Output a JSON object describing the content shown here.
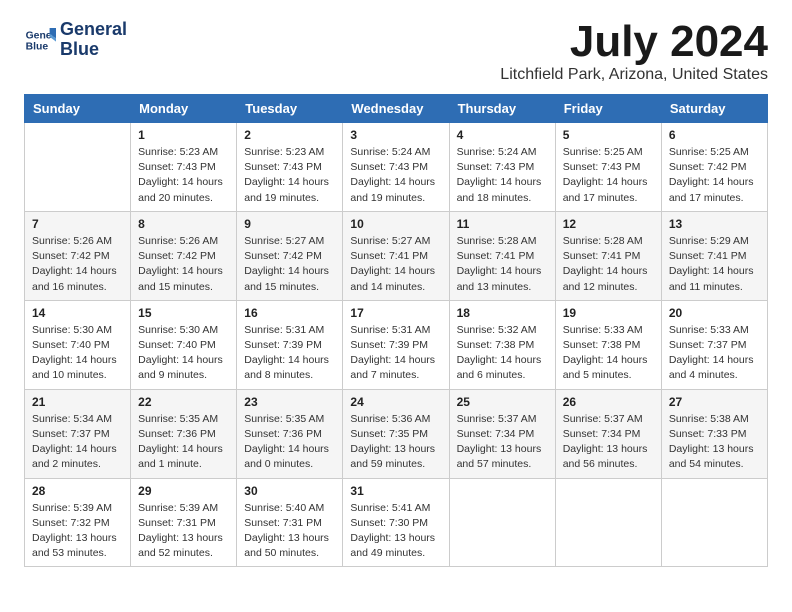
{
  "logo": {
    "line1": "General",
    "line2": "Blue"
  },
  "title": "July 2024",
  "location": "Litchfield Park, Arizona, United States",
  "days_of_week": [
    "Sunday",
    "Monday",
    "Tuesday",
    "Wednesday",
    "Thursday",
    "Friday",
    "Saturday"
  ],
  "weeks": [
    [
      {
        "date": "",
        "info": ""
      },
      {
        "date": "1",
        "info": "Sunrise: 5:23 AM\nSunset: 7:43 PM\nDaylight: 14 hours\nand 20 minutes."
      },
      {
        "date": "2",
        "info": "Sunrise: 5:23 AM\nSunset: 7:43 PM\nDaylight: 14 hours\nand 19 minutes."
      },
      {
        "date": "3",
        "info": "Sunrise: 5:24 AM\nSunset: 7:43 PM\nDaylight: 14 hours\nand 19 minutes."
      },
      {
        "date": "4",
        "info": "Sunrise: 5:24 AM\nSunset: 7:43 PM\nDaylight: 14 hours\nand 18 minutes."
      },
      {
        "date": "5",
        "info": "Sunrise: 5:25 AM\nSunset: 7:43 PM\nDaylight: 14 hours\nand 17 minutes."
      },
      {
        "date": "6",
        "info": "Sunrise: 5:25 AM\nSunset: 7:42 PM\nDaylight: 14 hours\nand 17 minutes."
      }
    ],
    [
      {
        "date": "7",
        "info": "Sunrise: 5:26 AM\nSunset: 7:42 PM\nDaylight: 14 hours\nand 16 minutes."
      },
      {
        "date": "8",
        "info": "Sunrise: 5:26 AM\nSunset: 7:42 PM\nDaylight: 14 hours\nand 15 minutes."
      },
      {
        "date": "9",
        "info": "Sunrise: 5:27 AM\nSunset: 7:42 PM\nDaylight: 14 hours\nand 15 minutes."
      },
      {
        "date": "10",
        "info": "Sunrise: 5:27 AM\nSunset: 7:41 PM\nDaylight: 14 hours\nand 14 minutes."
      },
      {
        "date": "11",
        "info": "Sunrise: 5:28 AM\nSunset: 7:41 PM\nDaylight: 14 hours\nand 13 minutes."
      },
      {
        "date": "12",
        "info": "Sunrise: 5:28 AM\nSunset: 7:41 PM\nDaylight: 14 hours\nand 12 minutes."
      },
      {
        "date": "13",
        "info": "Sunrise: 5:29 AM\nSunset: 7:41 PM\nDaylight: 14 hours\nand 11 minutes."
      }
    ],
    [
      {
        "date": "14",
        "info": "Sunrise: 5:30 AM\nSunset: 7:40 PM\nDaylight: 14 hours\nand 10 minutes."
      },
      {
        "date": "15",
        "info": "Sunrise: 5:30 AM\nSunset: 7:40 PM\nDaylight: 14 hours\nand 9 minutes."
      },
      {
        "date": "16",
        "info": "Sunrise: 5:31 AM\nSunset: 7:39 PM\nDaylight: 14 hours\nand 8 minutes."
      },
      {
        "date": "17",
        "info": "Sunrise: 5:31 AM\nSunset: 7:39 PM\nDaylight: 14 hours\nand 7 minutes."
      },
      {
        "date": "18",
        "info": "Sunrise: 5:32 AM\nSunset: 7:38 PM\nDaylight: 14 hours\nand 6 minutes."
      },
      {
        "date": "19",
        "info": "Sunrise: 5:33 AM\nSunset: 7:38 PM\nDaylight: 14 hours\nand 5 minutes."
      },
      {
        "date": "20",
        "info": "Sunrise: 5:33 AM\nSunset: 7:37 PM\nDaylight: 14 hours\nand 4 minutes."
      }
    ],
    [
      {
        "date": "21",
        "info": "Sunrise: 5:34 AM\nSunset: 7:37 PM\nDaylight: 14 hours\nand 2 minutes."
      },
      {
        "date": "22",
        "info": "Sunrise: 5:35 AM\nSunset: 7:36 PM\nDaylight: 14 hours\nand 1 minute."
      },
      {
        "date": "23",
        "info": "Sunrise: 5:35 AM\nSunset: 7:36 PM\nDaylight: 14 hours\nand 0 minutes."
      },
      {
        "date": "24",
        "info": "Sunrise: 5:36 AM\nSunset: 7:35 PM\nDaylight: 13 hours\nand 59 minutes."
      },
      {
        "date": "25",
        "info": "Sunrise: 5:37 AM\nSunset: 7:34 PM\nDaylight: 13 hours\nand 57 minutes."
      },
      {
        "date": "26",
        "info": "Sunrise: 5:37 AM\nSunset: 7:34 PM\nDaylight: 13 hours\nand 56 minutes."
      },
      {
        "date": "27",
        "info": "Sunrise: 5:38 AM\nSunset: 7:33 PM\nDaylight: 13 hours\nand 54 minutes."
      }
    ],
    [
      {
        "date": "28",
        "info": "Sunrise: 5:39 AM\nSunset: 7:32 PM\nDaylight: 13 hours\nand 53 minutes."
      },
      {
        "date": "29",
        "info": "Sunrise: 5:39 AM\nSunset: 7:31 PM\nDaylight: 13 hours\nand 52 minutes."
      },
      {
        "date": "30",
        "info": "Sunrise: 5:40 AM\nSunset: 7:31 PM\nDaylight: 13 hours\nand 50 minutes."
      },
      {
        "date": "31",
        "info": "Sunrise: 5:41 AM\nSunset: 7:30 PM\nDaylight: 13 hours\nand 49 minutes."
      },
      {
        "date": "",
        "info": ""
      },
      {
        "date": "",
        "info": ""
      },
      {
        "date": "",
        "info": ""
      }
    ]
  ]
}
